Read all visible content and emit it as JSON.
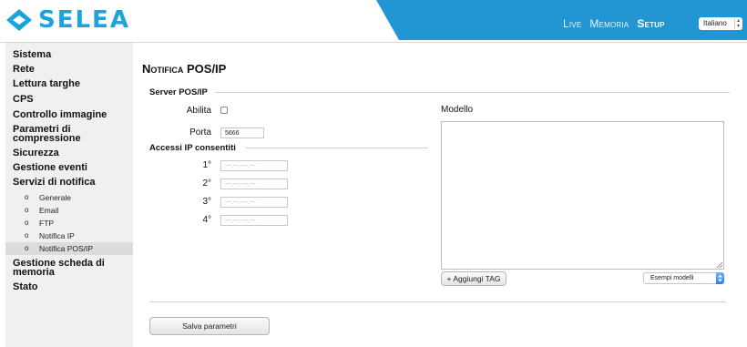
{
  "brand": {
    "name": "SELEA",
    "color": "#1aa4dc"
  },
  "header": {
    "accent_band": "#2196d3",
    "nav": [
      {
        "label": "Live",
        "active": false
      },
      {
        "label": "Memoria",
        "active": false
      },
      {
        "label": "Setup",
        "active": true
      }
    ],
    "language": {
      "selected": "Italiano"
    }
  },
  "sidebar": {
    "items": [
      {
        "label": "Sistema"
      },
      {
        "label": "Rete"
      },
      {
        "label": "Lettura targhe"
      },
      {
        "label": "CPS"
      },
      {
        "label": "Controllo immagine"
      },
      {
        "label": "Parametri di compressione"
      },
      {
        "label": "Sicurezza"
      },
      {
        "label": "Gestione eventi"
      },
      {
        "label": "Servizi di notifica"
      },
      {
        "label": "Gestione scheda di memoria"
      },
      {
        "label": "Stato"
      }
    ],
    "subitems": [
      {
        "label": "Generale",
        "active": false
      },
      {
        "label": "Email",
        "active": false
      },
      {
        "label": "FTP",
        "active": false
      },
      {
        "label": "Notifica IP",
        "active": false
      },
      {
        "label": "Notifica POS/IP",
        "active": true
      }
    ],
    "bullet": "o"
  },
  "main": {
    "title": "Notifica POS/IP",
    "server_section": {
      "title": "Server POS/IP",
      "enable_label": "Abilita",
      "enabled": false,
      "port_label": "Porta",
      "port_value": "5666"
    },
    "ip_section": {
      "title": "Accessi IP consentiti",
      "entries": [
        {
          "label": "1°",
          "placeholder": "---.---.---.---"
        },
        {
          "label": "2°",
          "placeholder": "---.---.---.---"
        },
        {
          "label": "3°",
          "placeholder": "---.---.---.---"
        },
        {
          "label": "4°",
          "placeholder": "---.---.---.---"
        }
      ]
    },
    "template": {
      "label": "Modello",
      "add_tag_button": "+ Aggiungi TAG",
      "examples_select": "Esempi modelli"
    },
    "save_button": "Salva parametri"
  }
}
